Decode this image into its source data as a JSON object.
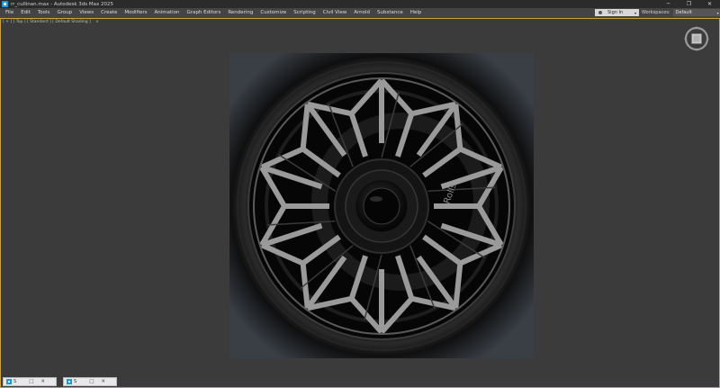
{
  "window": {
    "title": "rr_cullinan.max - Autodesk 3ds Max 2025",
    "minimize_glyph": "─",
    "maximize_glyph": "❐",
    "close_glyph": "✕"
  },
  "menu": [
    "File",
    "Edit",
    "Tools",
    "Group",
    "Views",
    "Create",
    "Modifiers",
    "Animation",
    "Graph Editors",
    "Rendering",
    "Customize",
    "Scripting",
    "Civil View",
    "Arnold",
    "Substance",
    "Help"
  ],
  "signin": {
    "label": "Sign In",
    "caret": "▾"
  },
  "workspaces": {
    "label": "Workspaces:",
    "value": "Default",
    "caret": "▾"
  },
  "viewport": {
    "label": "[ + ] [ Top ] [ Standard ] [ Default Shading ]",
    "close_glyph": "×"
  },
  "render": {
    "brand": "Rolls",
    "colors": {
      "spoke": "#9a9a9a",
      "tire": "#1a1a1a",
      "hub": "#0d0d0d"
    }
  },
  "minimized": [
    {
      "label": "S",
      "restore": "□",
      "close": "✕"
    },
    {
      "label": "S",
      "restore": "□",
      "close": "✕"
    }
  ]
}
